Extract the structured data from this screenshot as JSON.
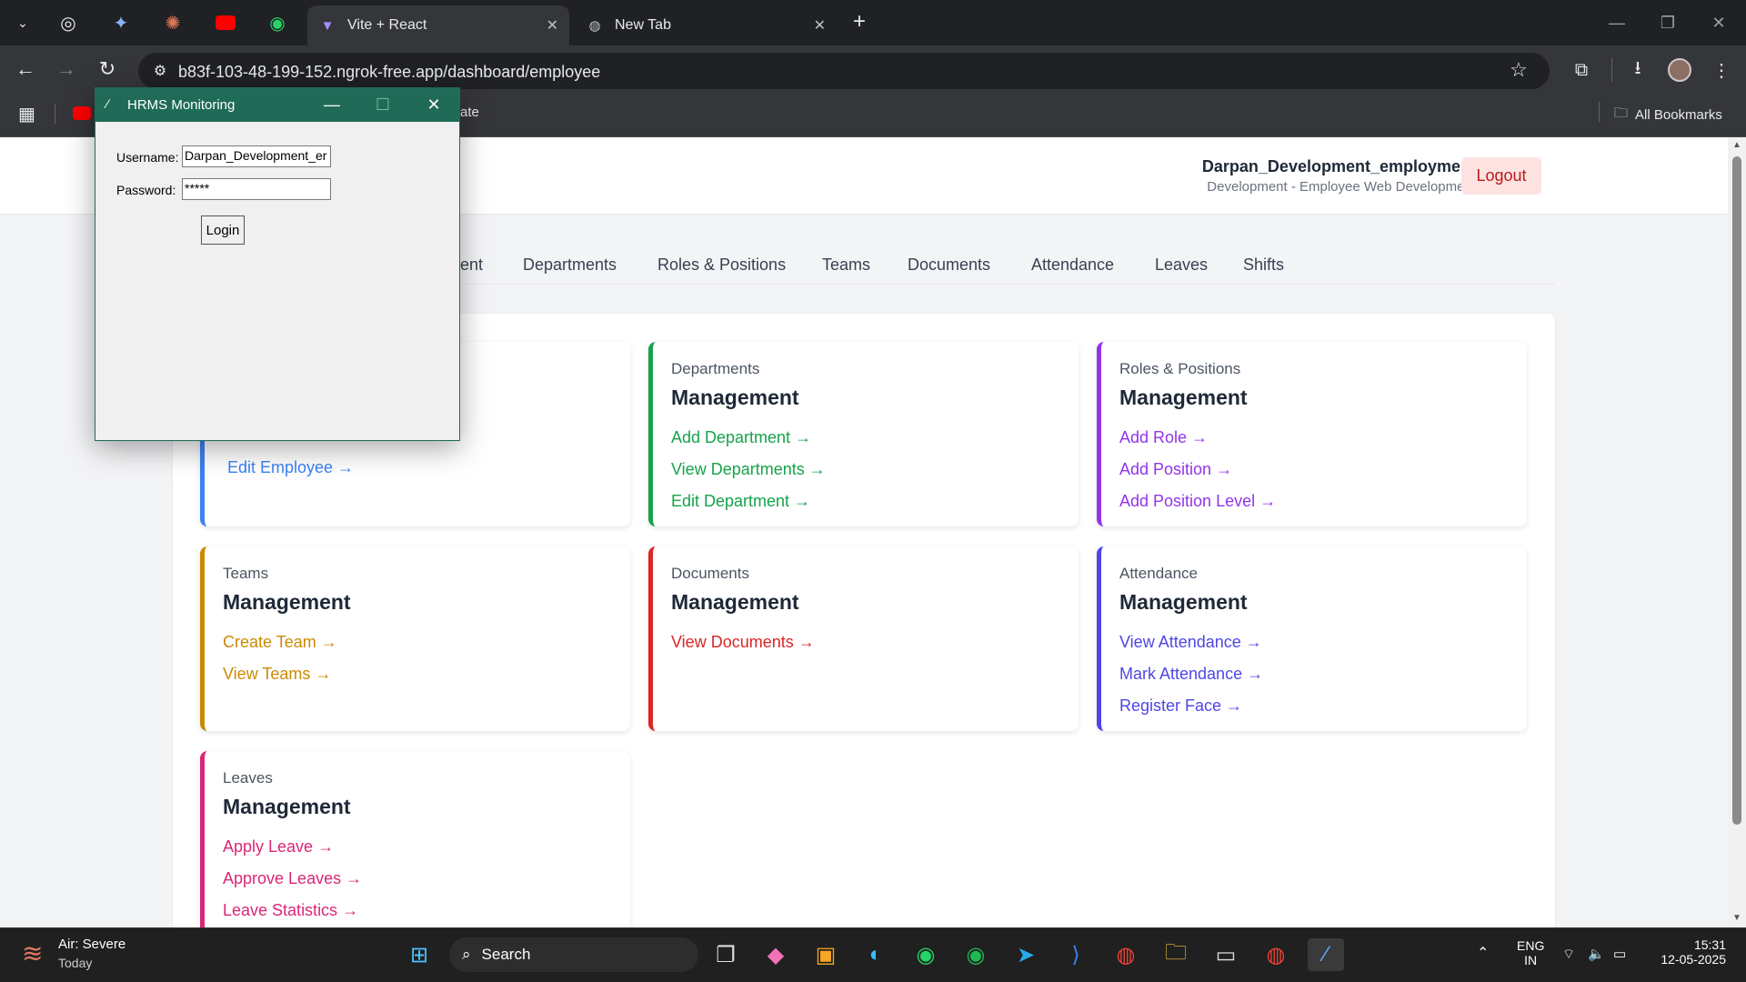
{
  "browser": {
    "tabs": [
      {
        "title": "Vite + React",
        "active": true
      },
      {
        "title": "New Tab",
        "active": false
      }
    ],
    "url": "b83f-103-48-199-152.ngrok-free.app/dashboard/employee",
    "bookmarks_label": "All Bookmarks",
    "bookmark_partial": "ate"
  },
  "header": {
    "user_name": "Darpan_Development_employment",
    "user_sub": "Development - Employee Web Development",
    "logout_label": "Logout"
  },
  "nav": {
    "partial_first": "ent",
    "items": [
      "Departments",
      "Roles & Positions",
      "Teams",
      "Documents",
      "Attendance",
      "Leaves",
      "Shifts"
    ]
  },
  "cards": [
    {
      "category": "",
      "title": "",
      "links": [
        "Edit Employee →"
      ],
      "color": "#3b82f6"
    },
    {
      "category": "Departments",
      "title": "Management",
      "links": [
        "Add Department →",
        "View Departments →",
        "Edit Department →"
      ],
      "color": "#16a34a"
    },
    {
      "category": "Roles & Positions",
      "title": "Management",
      "links": [
        "Add Role →",
        "Add Position →",
        "Add Position Level →"
      ],
      "color": "#9333ea"
    },
    {
      "category": "Teams",
      "title": "Management",
      "links": [
        "Create Team →",
        "View Teams →"
      ],
      "color": "#ca8a04"
    },
    {
      "category": "Documents",
      "title": "Management",
      "links": [
        "View Documents →"
      ],
      "color": "#dc2626"
    },
    {
      "category": "Attendance",
      "title": "Management",
      "links": [
        "View Attendance →",
        "Mark Attendance →",
        "Register Face →"
      ],
      "color": "#4f46e5"
    },
    {
      "category": "Leaves",
      "title": "Management",
      "links": [
        "Apply Leave →",
        "Approve Leaves →",
        "Leave Statistics →"
      ],
      "color": "#db2777"
    }
  ],
  "dialog": {
    "title": "HRMS Monitoring",
    "username_label": "Username:",
    "username_value": "Darpan_Development_er",
    "password_label": "Password:",
    "password_value": "*****",
    "login_label": "Login"
  },
  "taskbar": {
    "weather_title": "Air: Severe",
    "weather_sub": "Today",
    "search_label": "Search",
    "lang_top": "ENG",
    "lang_bottom": "IN",
    "time": "15:31",
    "date": "12-05-2025"
  }
}
